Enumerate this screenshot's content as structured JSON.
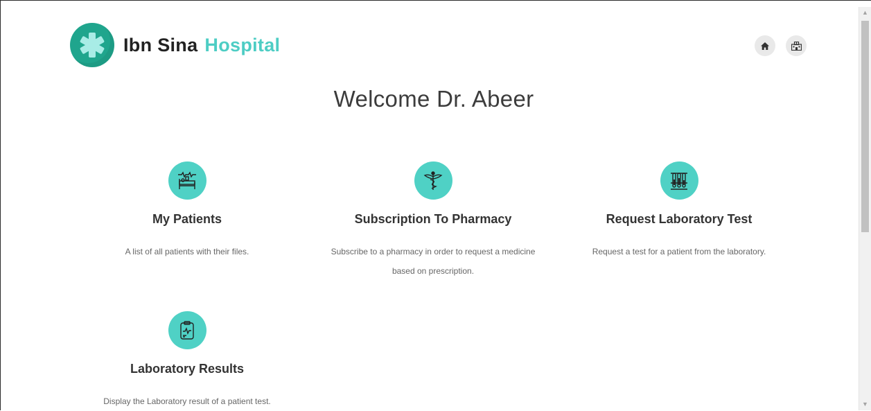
{
  "brand": {
    "name_part1": "Ibn Sina",
    "name_part2": "Hospital",
    "logo_icon": "asterisk-medical-icon",
    "accent_color": "#4ecdc4",
    "logo_color": "#1fa58d"
  },
  "header": {
    "buttons": [
      {
        "icon": "home-icon"
      },
      {
        "icon": "hospital-icon"
      }
    ]
  },
  "welcome": "Welcome Dr. Abeer",
  "cards": [
    {
      "icon": "patient-bed-icon",
      "title": "My Patients",
      "description": "A list of all patients with their files."
    },
    {
      "icon": "caduceus-icon",
      "title": "Subscription To Pharmacy",
      "description": "Subscribe to a pharmacy in order to request a medicine based on prescription."
    },
    {
      "icon": "test-tubes-icon",
      "title": "Request Laboratory Test",
      "description": "Request a test for a patient from the laboratory."
    },
    {
      "icon": "clipboard-results-icon",
      "title": "Laboratory Results",
      "description": "Display the Laboratory result of a patient test."
    }
  ],
  "colors": {
    "icon_circle": "#4fd1c5",
    "header_button_bg": "#e9e9e9"
  }
}
